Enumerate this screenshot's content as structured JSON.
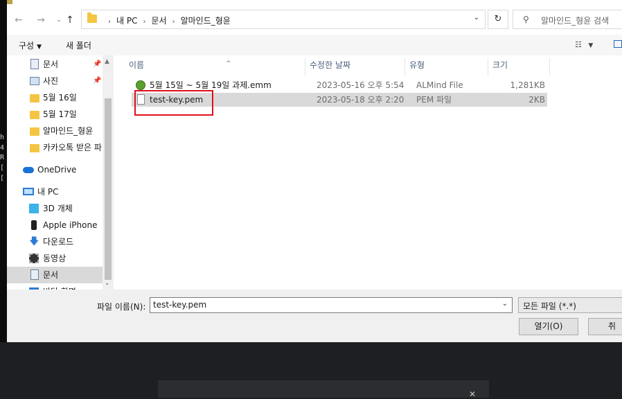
{
  "address": {
    "crumbs": [
      "내 PC",
      "문서",
      "알마인드_형윤"
    ]
  },
  "search": {
    "placeholder": "알마인드_형윤 검색"
  },
  "toolbar": {
    "organize": "구성",
    "new_folder": "새 폴더"
  },
  "sidebar": {
    "items": [
      {
        "label": "문서",
        "icon": "document-icon",
        "pinned": true
      },
      {
        "label": "사진",
        "icon": "picture-icon",
        "pinned": true
      },
      {
        "label": "5월 16일",
        "icon": "folder-icon"
      },
      {
        "label": "5월 17일",
        "icon": "folder-icon"
      },
      {
        "label": "알마인드_형윤",
        "icon": "folder-icon"
      },
      {
        "label": "카카오톡 받은 파",
        "icon": "folder-icon"
      },
      {
        "label": "OneDrive",
        "icon": "cloud-icon"
      },
      {
        "label": "내 PC",
        "icon": "pc-icon"
      },
      {
        "label": "3D 개체",
        "icon": "cube-icon"
      },
      {
        "label": "Apple iPhone",
        "icon": "phone-icon"
      },
      {
        "label": "다운로드",
        "icon": "download-icon"
      },
      {
        "label": "동영상",
        "icon": "video-icon"
      },
      {
        "label": "문서",
        "icon": "document-icon"
      },
      {
        "label": "바탕 화면",
        "icon": "desktop-icon"
      }
    ]
  },
  "columns": {
    "name": "이름",
    "date": "수정한 날짜",
    "type": "유형",
    "size": "크기"
  },
  "files": [
    {
      "name": "5월 15일 ~ 5월 19일 과제.emm",
      "date": "2023-05-16 오후 5:54",
      "type": "ALMind File",
      "size": "1,281KB",
      "icon": "almind-file-icon"
    },
    {
      "name": "test-key.pem",
      "date": "2023-05-18 오후 2:20",
      "type": "PEM 파일",
      "size": "2KB",
      "icon": "generic-file-icon"
    }
  ],
  "bottom": {
    "filename_label": "파일 이름(N):",
    "filename_value": "test-key.pem",
    "filter": "모든 파일 (*.*)",
    "open": "열기(O)",
    "cancel": "취소"
  },
  "background": {
    "terminal_chars": [
      "h",
      "4",
      "R",
      "[",
      "["
    ]
  },
  "colors": {
    "selection": "#d9d9d9",
    "highlight_box": "#e0101a",
    "accent": "#1a66c2"
  }
}
